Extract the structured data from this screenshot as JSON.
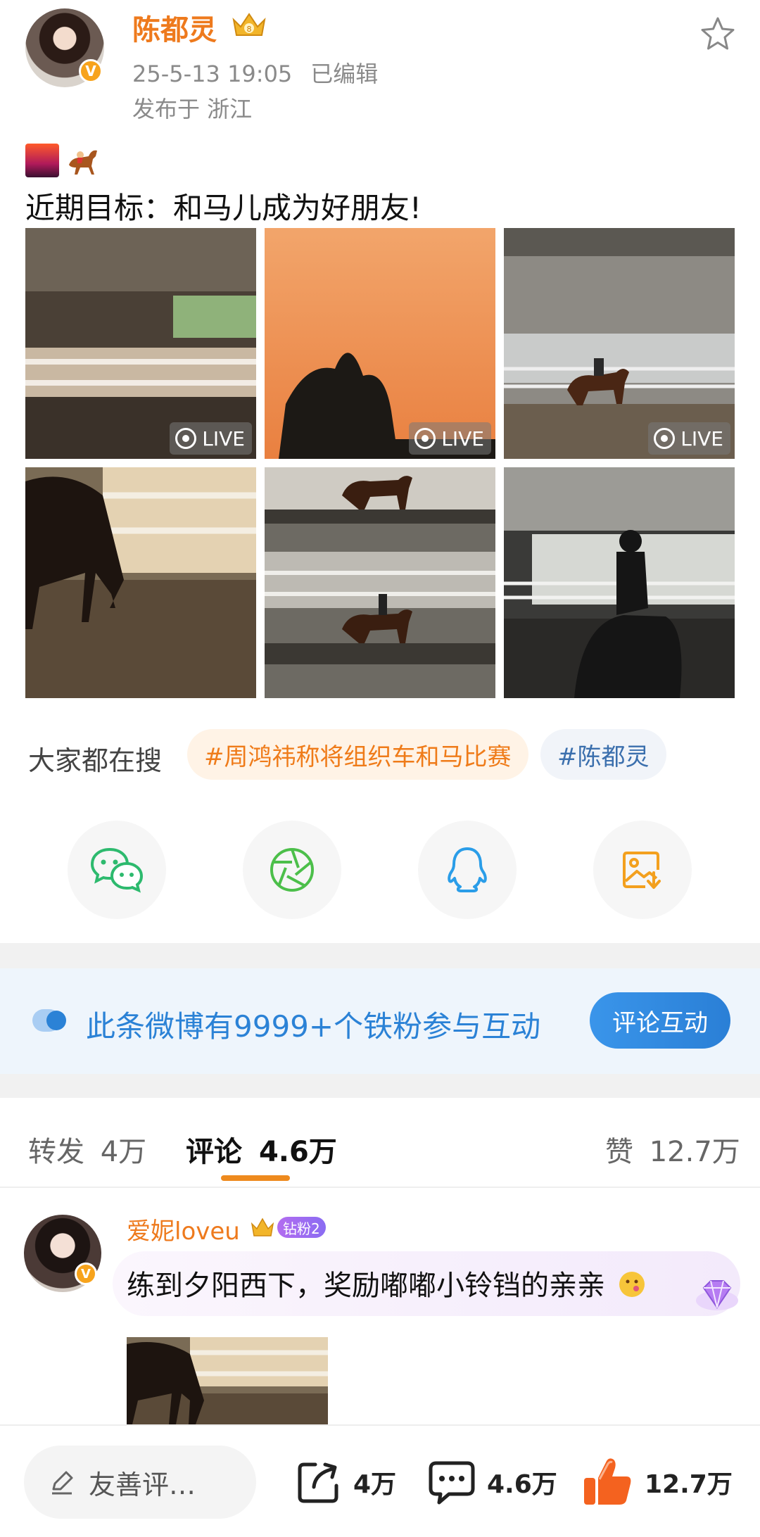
{
  "post": {
    "author": "陈都灵",
    "timestamp": "25-5-13 19:05",
    "edited": "已编辑",
    "location": "发布于 浙江",
    "text": "近期目标：和马儿成为好朋友!",
    "live_label": "LIVE"
  },
  "search": {
    "label": "大家都在搜",
    "chips": [
      "#周鸿祎称将组织车和马比赛",
      "#陈都灵"
    ]
  },
  "share": {
    "icons": [
      "wechat-icon",
      "moments-icon",
      "qq-icon",
      "save-image-icon"
    ]
  },
  "fans_banner": {
    "text": "此条微博有9999+个铁粉参与互动",
    "button": "评论互动"
  },
  "tabs": {
    "repost_label": "转发",
    "repost_count": "4万",
    "comment_label": "评论",
    "comment_count": "4.6万",
    "like_label": "赞",
    "like_count": "12.7万"
  },
  "comment": {
    "username": "爱妮loveu",
    "fan_badge": "钻粉2",
    "text": "练到夕阳西下，奖励嘟嘟小铃铛的亲亲"
  },
  "bottom_bar": {
    "composer_placeholder": "友善评…",
    "repost_count": "4万",
    "comment_count": "4.6万",
    "like_count": "12.7万"
  },
  "colors": {
    "accent_orange": "#ee7a1d",
    "link_blue": "#2b82d6",
    "like_orange": "#f4621f"
  }
}
